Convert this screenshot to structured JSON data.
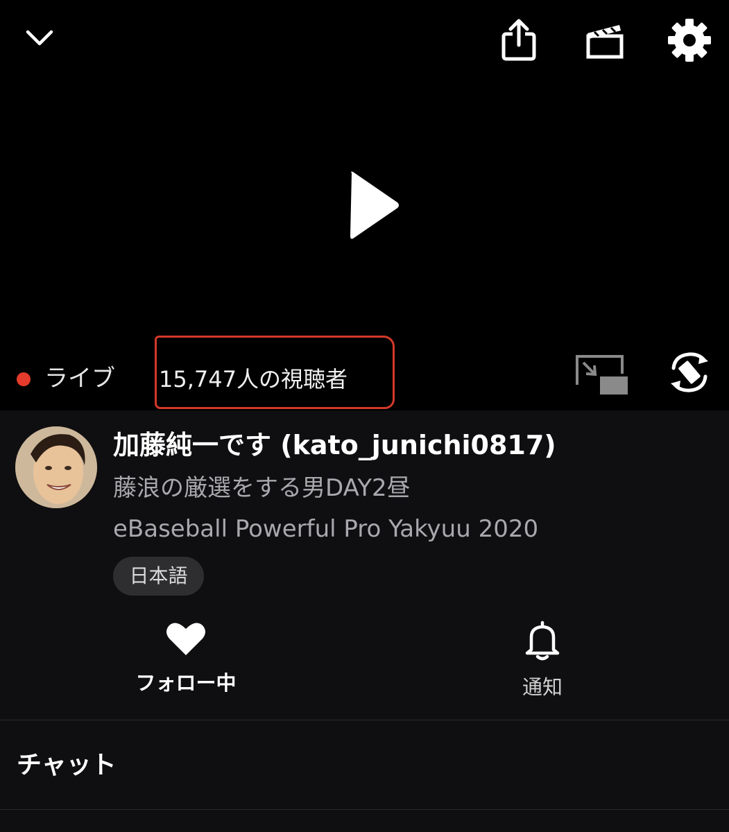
{
  "player": {
    "icons": {
      "collapse": "chevron-down-icon",
      "share": "share-icon",
      "clip": "clapperboard-icon",
      "settings": "gear-icon",
      "play": "play-icon",
      "pip": "picture-in-picture-icon",
      "rotate": "rotate-screen-icon"
    },
    "live_label": "ライブ",
    "viewers": "15,747人の視聴者",
    "colors": {
      "live_dot": "#e53b2c",
      "annotation": "#d4392a"
    }
  },
  "stream": {
    "channel_name": "加藤純一です (kato_junichi0817)",
    "title": "藤浪の厳選をする男DAY2昼",
    "game": "eBaseball Powerful Pro Yakyuu 2020",
    "language_tag": "日本語"
  },
  "actions": {
    "follow": {
      "label": "フォロー中",
      "icon": "heart-icon"
    },
    "notify": {
      "label": "通知",
      "icon": "bell-icon"
    }
  },
  "chat": {
    "title": "チャット"
  }
}
